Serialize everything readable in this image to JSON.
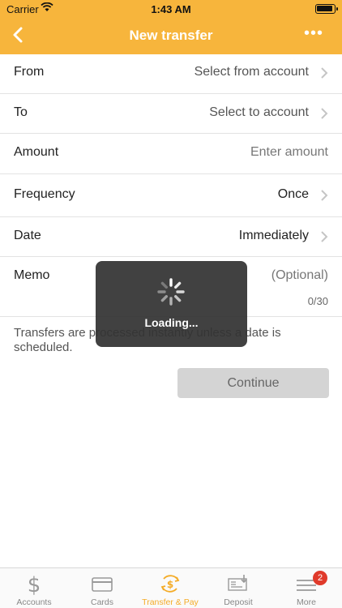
{
  "status_bar": {
    "carrier": "Carrier",
    "time": "1:43 AM"
  },
  "nav": {
    "title": "New transfer",
    "more_label": "•••"
  },
  "form": {
    "from": {
      "label": "From",
      "value": "Select from account"
    },
    "to": {
      "label": "To",
      "value": "Select to account"
    },
    "amount": {
      "label": "Amount",
      "placeholder": "Enter amount"
    },
    "frequency": {
      "label": "Frequency",
      "value": "Once"
    },
    "date": {
      "label": "Date",
      "value": "Immediately"
    },
    "memo": {
      "label": "Memo",
      "placeholder": "(Optional)",
      "counter": "0/30"
    }
  },
  "info_text": "Transfers are processed instantly unless a date is scheduled.",
  "continue_label": "Continue",
  "loading": {
    "label": "Loading..."
  },
  "tabs": [
    {
      "label": "Accounts",
      "icon": "dollar-icon"
    },
    {
      "label": "Cards",
      "icon": "card-icon"
    },
    {
      "label": "Transfer & Pay",
      "icon": "transfer-icon",
      "active": true
    },
    {
      "label": "Deposit",
      "icon": "check-deposit-icon"
    },
    {
      "label": "More",
      "icon": "menu-icon",
      "badge": "2"
    }
  ],
  "colors": {
    "accent": "#f7b53c",
    "active_tab": "#f4ac28",
    "badge": "#e03a2b"
  }
}
